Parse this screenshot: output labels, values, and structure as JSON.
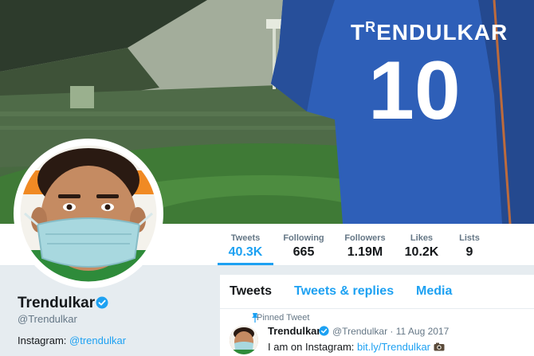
{
  "banner": {
    "jersey_name_prefix": "T",
    "jersey_name_r": "R",
    "jersey_name_rest": "ENDULKAR",
    "jersey_number": "10"
  },
  "stats": [
    {
      "label": "Tweets",
      "value": "40.3K",
      "active": true
    },
    {
      "label": "Following",
      "value": "665",
      "active": false
    },
    {
      "label": "Followers",
      "value": "1.19M",
      "active": false
    },
    {
      "label": "Likes",
      "value": "10.2K",
      "active": false
    },
    {
      "label": "Lists",
      "value": "9",
      "active": false
    }
  ],
  "profile": {
    "name": "Trendulkar",
    "handle": "@Trendulkar",
    "bio_prefix": "Instagram: ",
    "bio_link": "@trendulkar"
  },
  "timeline": {
    "tabs": [
      "Tweets",
      "Tweets & replies",
      "Media"
    ],
    "pinned_label": "Pinned Tweet",
    "tweet": {
      "name": "Trendulkar",
      "meta": "@Trendulkar · 11 Aug 2017",
      "text_prefix": "I am on Instagram: ",
      "text_link": "bit.ly/Trendulkar"
    }
  },
  "colors": {
    "accent": "#1da1f2",
    "jersey_blue": "#2e5fb8",
    "text_primary": "#14171a",
    "text_secondary": "#657786"
  },
  "icons": [
    "verified-badge-icon",
    "pin-icon",
    "camera-icon"
  ]
}
